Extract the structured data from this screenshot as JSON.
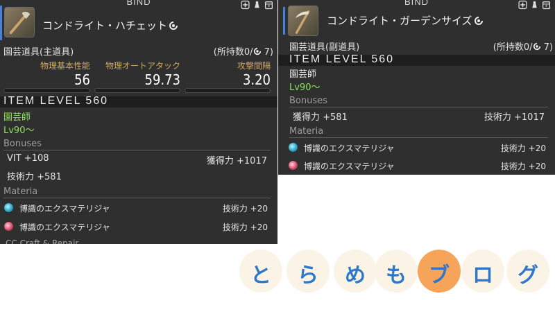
{
  "left": {
    "bind": "BIND",
    "item_name": "コンドライト・ハチェット",
    "category": "園芸道具(主道具)",
    "possession": "(所持数0/",
    "possession_count": "7)",
    "stats": [
      {
        "label": "物理基本性能",
        "value": "56"
      },
      {
        "label": "物理オートアタック",
        "value": "59.73"
      },
      {
        "label": "攻撃間隔",
        "value": "3.20"
      }
    ],
    "item_level": "ITEM LEVEL 560",
    "job": "園芸師",
    "level": "Lv90〜",
    "bonuses_header": "Bonuses",
    "bonuses": [
      {
        "left": "VIT +108",
        "right": "獲得力 +1017"
      },
      {
        "left": "技術力 +581",
        "right": ""
      }
    ],
    "materia_header": "Materia",
    "materia": [
      {
        "name": "博識のエクスマテリジャ",
        "effect": "技術力 +20",
        "color": "#2aa5c7"
      },
      {
        "name": "博識のエクスマテリジャ",
        "effect": "技術力 +20",
        "color": "#d64a6a"
      }
    ],
    "cut_off_text": "CC Craft & Repair"
  },
  "right": {
    "bind": "BIND",
    "item_name": "コンドライト・ガーデンサイズ",
    "category": "園芸道具(副道具)",
    "possession": "(所持数0/",
    "possession_count": "7)",
    "item_level": "ITEM LEVEL 560",
    "job": "園芸師",
    "level": "Lv90〜",
    "bonuses_header": "Bonuses",
    "bonuses": [
      {
        "left": "獲得力 +581",
        "right": "技術力 +1017"
      }
    ],
    "materia_header": "Materia",
    "materia": [
      {
        "name": "博識のエクスマテリジャ",
        "effect": "技術力 +20",
        "color": "#2aa5c7"
      },
      {
        "name": "博識のエクスマテリジャ",
        "effect": "技術力 +20",
        "color": "#d64a6a"
      }
    ]
  },
  "brand": {
    "chars": [
      "と",
      "ら",
      "め",
      "も",
      "ブ",
      "ロ",
      "グ"
    ],
    "highlight_color": "#f6a45a",
    "text_color": "#2d78c8"
  },
  "icons": [
    "plus-icon",
    "glamour-icon",
    "armoire-icon",
    "element-swirl-icon",
    "hatchet-icon",
    "scythe-icon"
  ]
}
